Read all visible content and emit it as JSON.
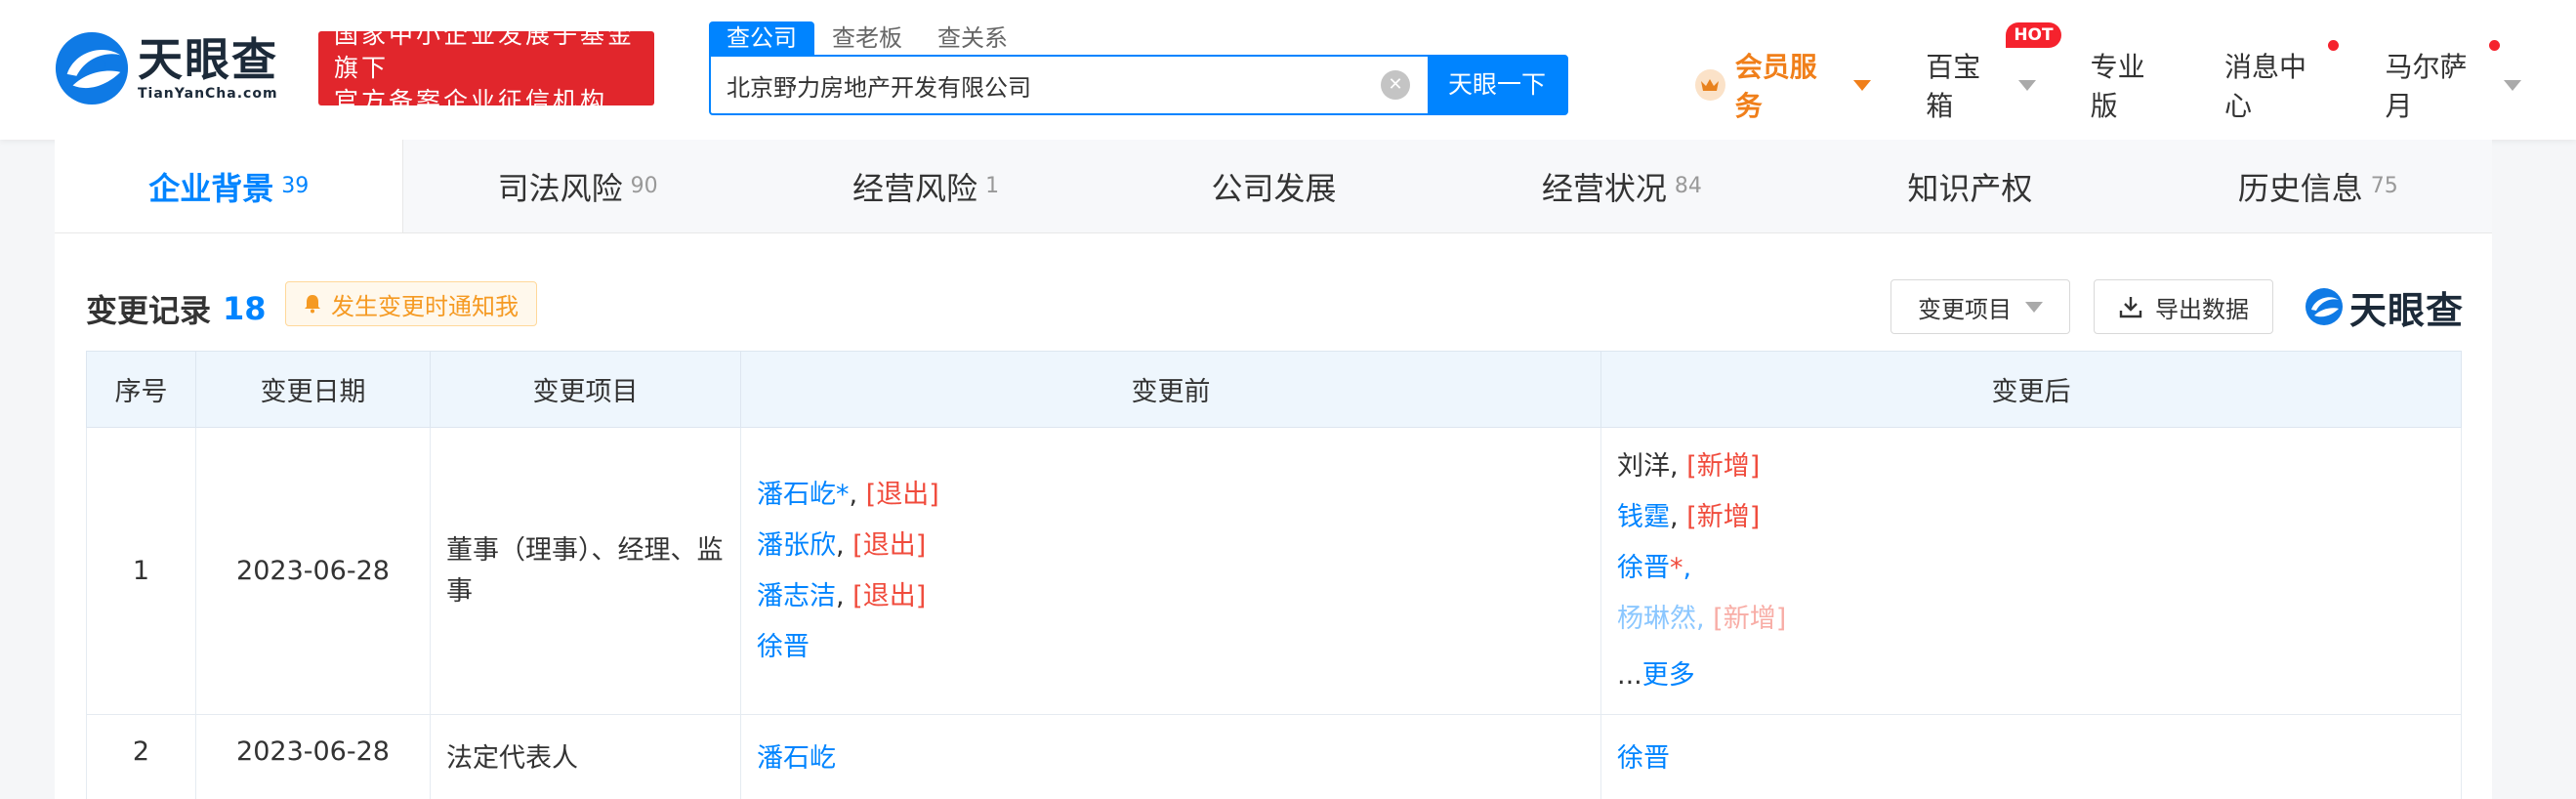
{
  "header": {
    "logo_cn": "天眼查",
    "logo_en": "TianYanCha.com",
    "slogan_line1": "国家中小企业发展子基金旗下",
    "slogan_line2": "官方备案企业征信机构",
    "search_tabs": [
      "查公司",
      "查老板",
      "查关系"
    ],
    "search_value": "北京野力房地产开发有限公司",
    "search_button": "天眼一下",
    "nav": {
      "vip": "会员服务",
      "toolbox": "百宝箱",
      "hot": "HOT",
      "pro": "专业版",
      "messages": "消息中心",
      "user": "马尔萨月"
    }
  },
  "tabs": [
    {
      "label": "企业背景",
      "count": "39"
    },
    {
      "label": "司法风险",
      "count": "90"
    },
    {
      "label": "经营风险",
      "count": "1"
    },
    {
      "label": "公司发展",
      "count": ""
    },
    {
      "label": "经营状况",
      "count": "84"
    },
    {
      "label": "知识产权",
      "count": ""
    },
    {
      "label": "历史信息",
      "count": "75"
    }
  ],
  "section": {
    "title": "变更记录",
    "count": "18",
    "notify": "发生变更时通知我",
    "filter": "变更项目",
    "export": "导出数据",
    "watermark": "天眼查"
  },
  "table": {
    "headers": [
      "序号",
      "变更日期",
      "变更项目",
      "变更前",
      "变更后"
    ],
    "rows": [
      {
        "index": "1",
        "date": "2023-06-28",
        "item": "董事（理事）、经理、监事",
        "before": [
          {
            "name": "潘石屹*",
            "sep": ", ",
            "tag": "[退出]"
          },
          {
            "name": "潘张欣",
            "sep": ", ",
            "tag": "[退出]"
          },
          {
            "name": "潘志洁",
            "sep": ", ",
            "tag": "[退出]"
          },
          {
            "name": "徐晋",
            "sep": "",
            "tag": ""
          }
        ],
        "after": [
          {
            "name": "刘洋",
            "sep": ", ",
            "tag": "[新增]"
          },
          {
            "name": "钱霆",
            "sep": ", ",
            "tag": "[新增]"
          },
          {
            "name": "徐晋",
            "star": "*",
            "sep": ",",
            "tag": ""
          },
          {
            "name": "杨琳然",
            "sep": ", ",
            "tag": "[新增]"
          }
        ],
        "ellipsis": "...",
        "more": "更多"
      },
      {
        "index": "2",
        "date": "2023-06-28",
        "item": "法定代表人",
        "before": "潘石屹",
        "after": "徐晋"
      }
    ]
  }
}
